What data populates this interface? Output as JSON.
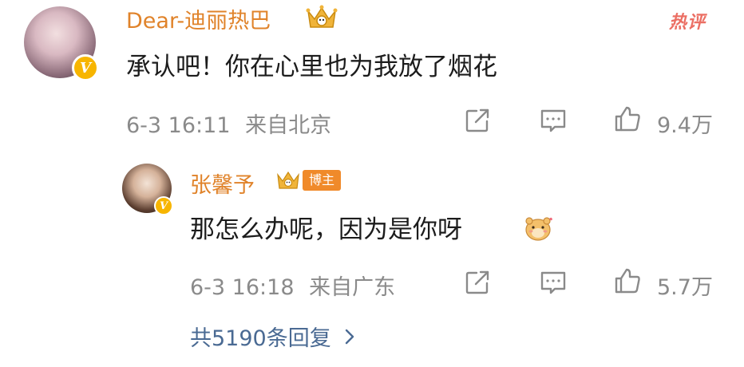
{
  "main_comment": {
    "username": "Dear-迪丽热巴",
    "hot_label": "热评",
    "text": "承认吧！你在心里也为我放了烟花",
    "timestamp": "6-3 16:11",
    "location": "来自北京",
    "likes": "9.4万",
    "verified_badge": "V",
    "icons": [
      "avatar",
      "verified-badge",
      "crown-badge",
      "share-icon",
      "comment-icon",
      "like-icon"
    ]
  },
  "reply": {
    "username": "张馨予",
    "blogger_label": "博主",
    "text": "那怎么办呢，因为是你呀",
    "timestamp": "6-3 16:18",
    "location": "来自广东",
    "likes": "5.7万",
    "verified_badge": "V",
    "icons": [
      "avatar",
      "verified-badge",
      "crown-badge",
      "hamster-emoji",
      "share-icon",
      "comment-icon",
      "like-icon"
    ]
  },
  "more_replies": {
    "label": "共5190条回复"
  },
  "colors": {
    "username": "#e0832a",
    "meta": "#8a8a8a",
    "link": "#4a6a93",
    "hot": "#e8564a",
    "badge": "#f7b500"
  }
}
